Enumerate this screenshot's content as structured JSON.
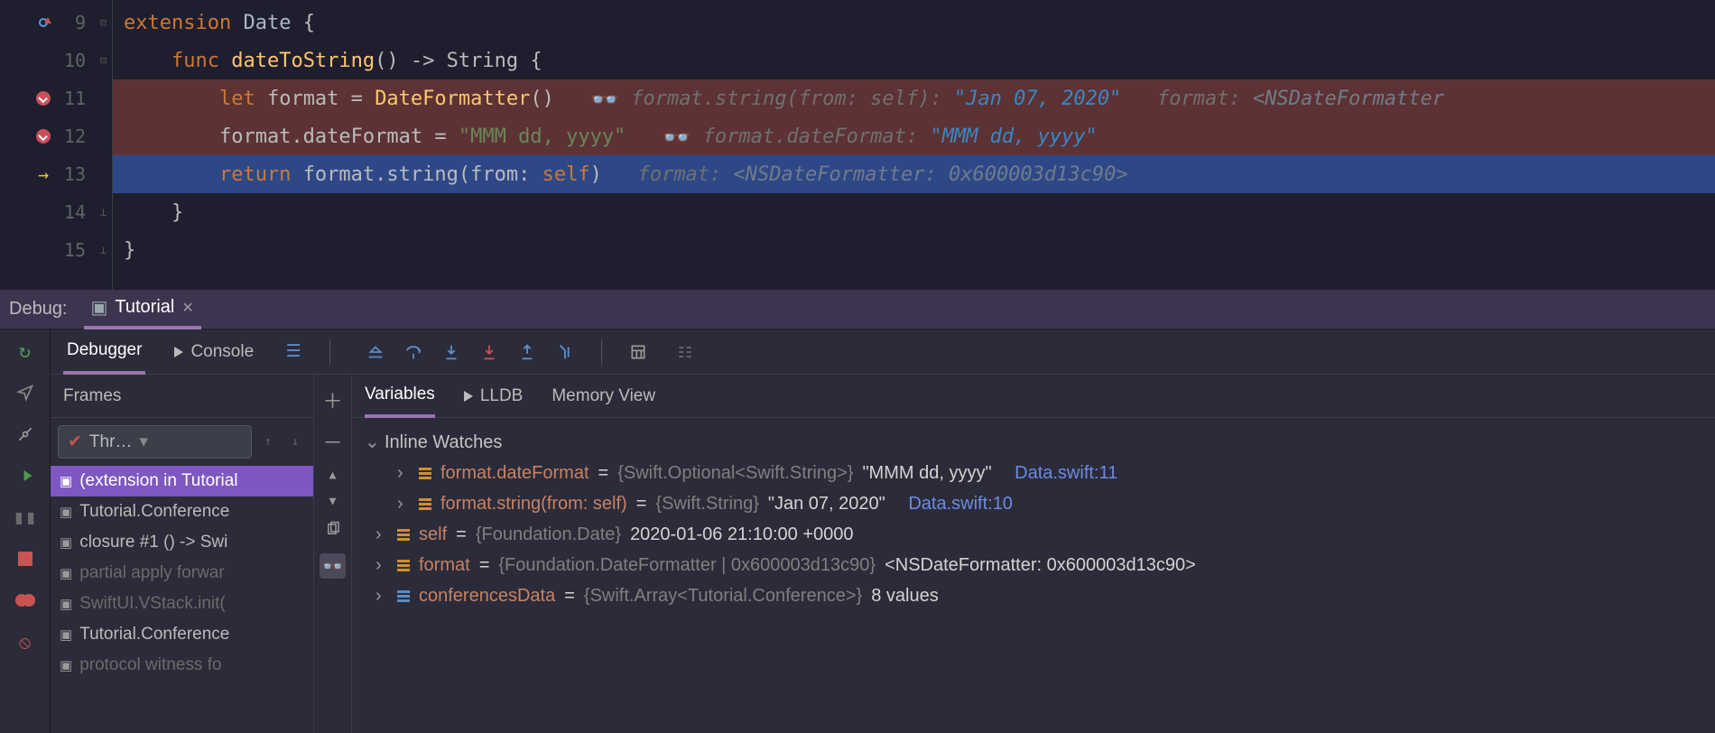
{
  "editor": {
    "lines": [
      {
        "num": 9
      },
      {
        "num": 10
      },
      {
        "num": 11
      },
      {
        "num": 12
      },
      {
        "num": 13
      },
      {
        "num": 14
      },
      {
        "num": 15
      }
    ],
    "code": {
      "l9_kw": "extension",
      "l9_ty": " Date ",
      "l9_br": "{",
      "l10_kw": "    func ",
      "l10_fn": "dateToString",
      "l10_rest": "() -> String {",
      "l11_kw": "        let ",
      "l11_var": "format",
      "l11_eq": " = ",
      "l11_call": "DateFormatter",
      "l11_par": "()",
      "l11_h1": "format.string(from: self): ",
      "l11_h1v": "\"Jan 07, 2020\"",
      "l11_h2": "   format: ",
      "l11_h2v": "<NSDateFormatter",
      "l12_a": "        format.dateFormat = ",
      "l12_s": "\"MMM dd, yyyy\"",
      "l12_h1": "format.dateFormat: ",
      "l12_h1v": "\"MMM dd, yyyy\"",
      "l13_kw": "        return ",
      "l13_rest": "format.string(from: ",
      "l13_self": "self",
      "l13_end": ")",
      "l13_h": "format: ",
      "l13_hv": "<NSDateFormatter: 0x600003d13c90>",
      "l14": "    }",
      "l15": "}"
    }
  },
  "debug": {
    "title": "Debug:",
    "tab": "Tutorial",
    "toolbar": {
      "debugger": "Debugger",
      "console": "Console"
    },
    "frames": {
      "label": "Frames",
      "thread": "Thr…",
      "items": [
        {
          "label": "(extension in Tutorial",
          "sel": true
        },
        {
          "label": "Tutorial.Conference"
        },
        {
          "label": "closure #1 () -> Swi"
        },
        {
          "label": "partial apply forwar",
          "dim": true
        },
        {
          "label": "SwiftUI.VStack.init(",
          "dim": true
        },
        {
          "label": "Tutorial.Conference"
        },
        {
          "label": "protocol witness fo",
          "dim": true
        }
      ]
    },
    "vars": {
      "tabs": {
        "variables": "Variables",
        "lldb": "LLDB",
        "memory": "Memory View"
      },
      "inline_watches": "Inline Watches",
      "rows": [
        {
          "indent": 2,
          "name": "format.dateFormat",
          "type": "{Swift.Optional<Swift.String>}",
          "val": "\"MMM dd, yyyy\"",
          "loc": "Data.swift:11",
          "icon": "orange"
        },
        {
          "indent": 2,
          "name": "format.string(from: self)",
          "type": "{Swift.String}",
          "val": "\"Jan 07, 2020\"",
          "loc": "Data.swift:10",
          "icon": "orange"
        },
        {
          "indent": 1,
          "name": "self",
          "type": "{Foundation.Date}",
          "val": "2020-01-06 21:10:00 +0000",
          "icon": "orange"
        },
        {
          "indent": 1,
          "name": "format",
          "type": "{Foundation.DateFormatter | 0x600003d13c90}",
          "val": "<NSDateFormatter: 0x600003d13c90>",
          "icon": "orange"
        },
        {
          "indent": 1,
          "name": "conferencesData",
          "type": "{Swift.Array<Tutorial.Conference>}",
          "val": "8 values",
          "icon": "blue"
        }
      ]
    }
  }
}
